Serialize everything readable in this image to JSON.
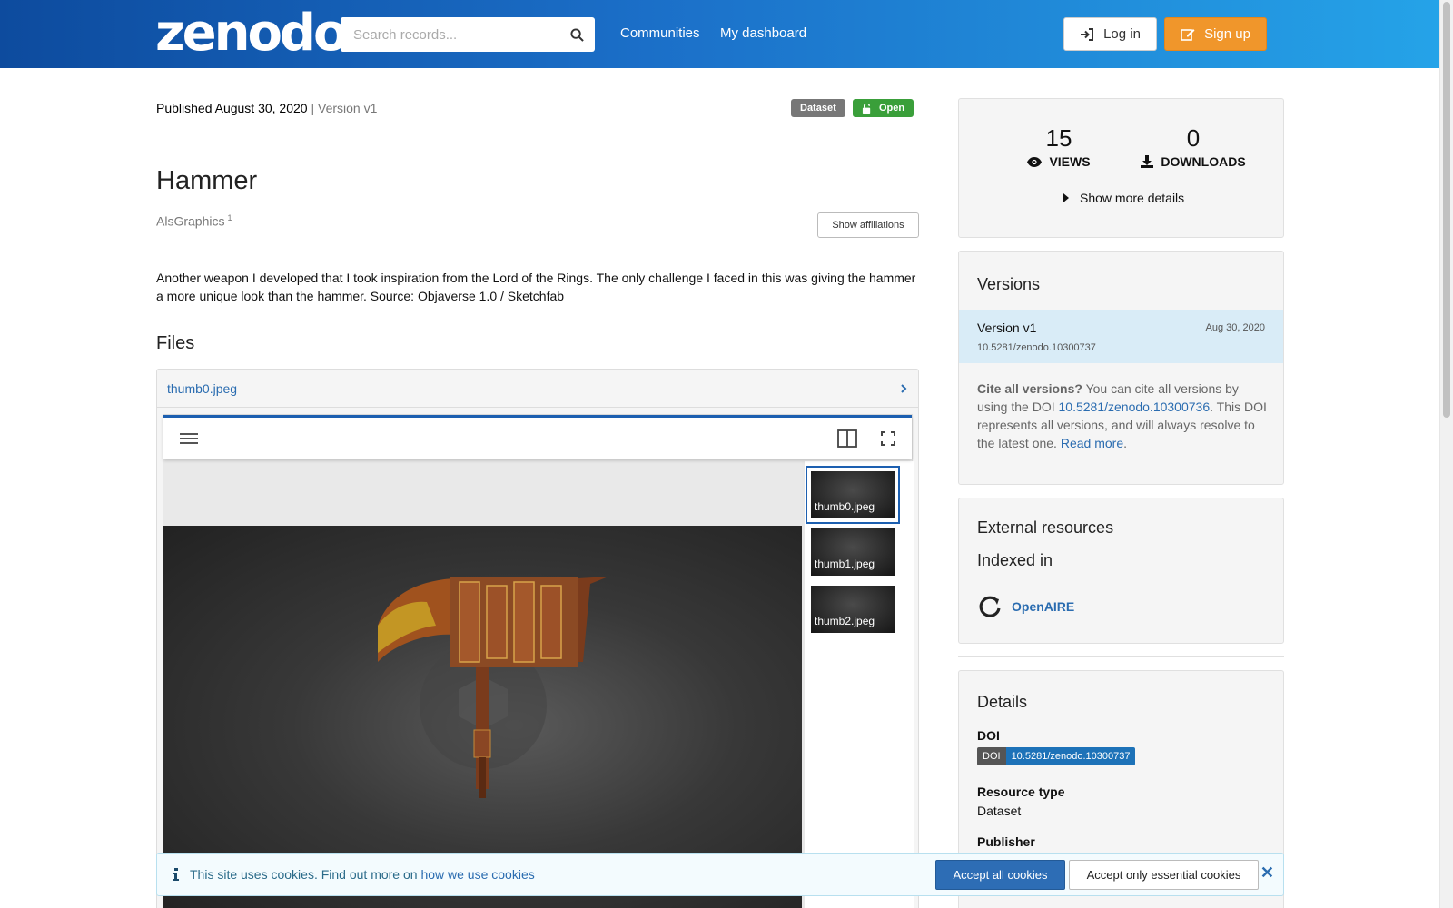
{
  "header": {
    "logo": "zenodo",
    "search_placeholder": "Search records...",
    "nav": [
      "Communities",
      "My dashboard"
    ],
    "login_label": "Log in",
    "signup_label": "Sign up"
  },
  "record": {
    "published": "Published August 30, 2020",
    "version_sep": " | ",
    "version": "Version v1",
    "badge_type": "Dataset",
    "badge_access": "Open",
    "title": "Hammer",
    "author": "AlsGraphics",
    "author_sup": "1",
    "affiliations_button": "Show affiliations",
    "description": "Another weapon I developed that I took inspiration from the Lord of the Rings. The only challenge I faced in this was giving the hammer a more unique look than the hammer. Source: Objaverse 1.0 / Sketchfab"
  },
  "files": {
    "heading": "Files",
    "file_name": "thumb0.jpeg",
    "thumbnails": [
      "thumb0.jpeg",
      "thumb1.jpeg",
      "thumb2.jpeg"
    ]
  },
  "stats": {
    "views": "15",
    "views_label": "VIEWS",
    "downloads": "0",
    "downloads_label": "DOWNLOADS",
    "more_details": "Show more details"
  },
  "versions": {
    "heading": "Versions",
    "item_name": "Version v1",
    "item_date": "Aug 30, 2020",
    "item_doi": "10.5281/zenodo.10300737",
    "cite_bold": "Cite all versions?",
    "cite_text1": " You can cite all versions by using the DOI ",
    "cite_doi": "10.5281/zenodo.10300736",
    "cite_text2": ". This DOI represents all versions, and will always resolve to the latest one. ",
    "read_more": "Read more",
    "period": "."
  },
  "external": {
    "heading": "External resources",
    "indexed_in": "Indexed in",
    "openaire": "OpenAIRE"
  },
  "details": {
    "heading": "Details",
    "doi_label": "DOI",
    "doi_badge_key": "DOI",
    "doi_badge_value": "10.5281/zenodo.10300737",
    "resource_type_label": "Resource type",
    "resource_type_value": "Dataset",
    "publisher_label": "Publisher"
  },
  "cookie": {
    "text": "This site uses cookies. Find out more on ",
    "link": "how we use cookies",
    "accept_all": "Accept all cookies",
    "accept_essential": "Accept only essential cookies"
  },
  "colors": {
    "header_start": "#0d4b9e",
    "header_end": "#25a3e8",
    "signup": "#f0962b",
    "open_badge": "#3a9f3a",
    "link": "#2a6cb0"
  }
}
